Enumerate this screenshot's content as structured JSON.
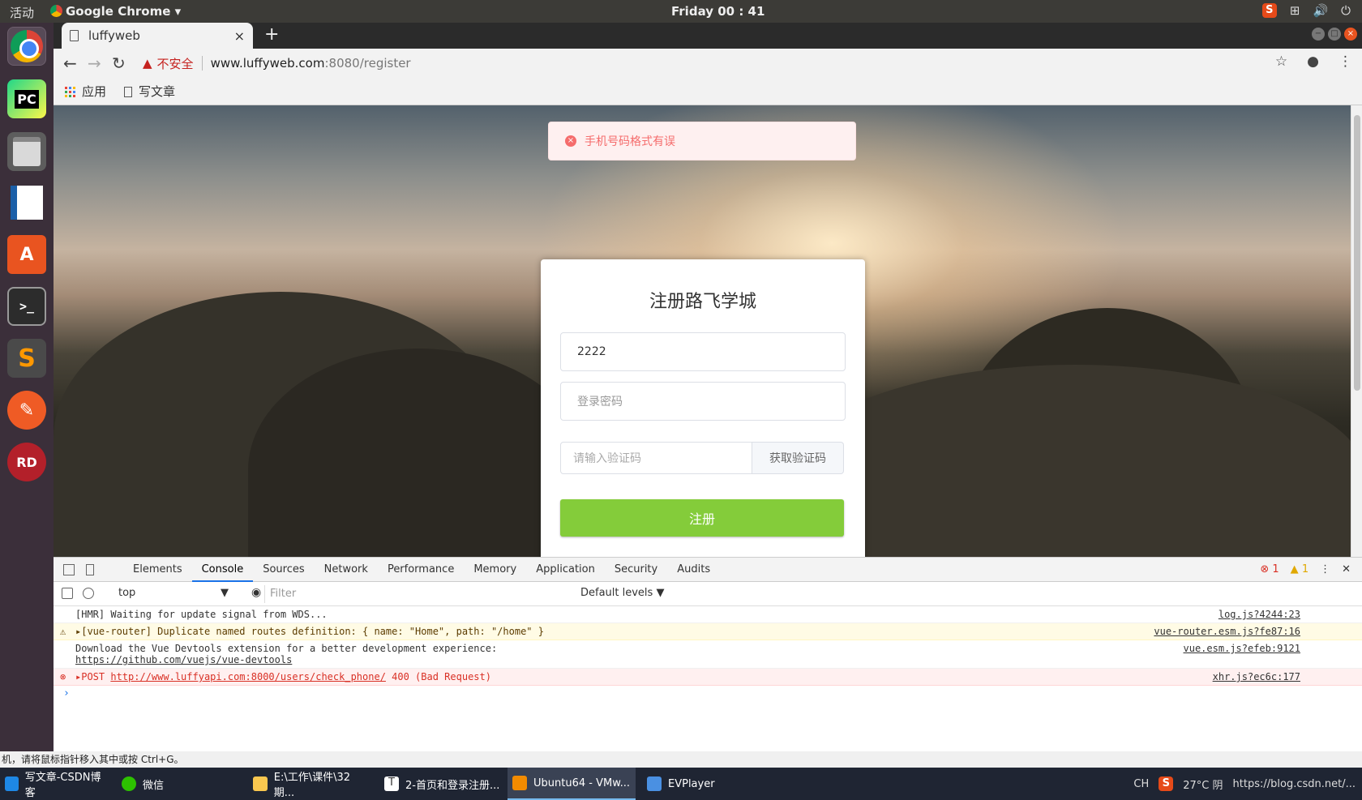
{
  "topbar": {
    "activities": "活动",
    "app_name": "Google Chrome",
    "app_menu_arrow": "▾",
    "clock": "Friday 00 : 41"
  },
  "launcher": {
    "pycharm_label": "PC",
    "terminal_label": ">_",
    "sublime_label": "S",
    "store_label": "A",
    "rdm_label": "RD"
  },
  "browser": {
    "tab_title": "luffyweb",
    "tab_close": "×",
    "new_tab": "+",
    "insecure_label": "不安全",
    "url_host": "www.luffyweb.com",
    "url_path": ":8080/register",
    "bookmarks": {
      "apps": "应用",
      "item1": "写文章"
    }
  },
  "page": {
    "error_message": "手机号码格式有误",
    "title": "注册路飞学城",
    "phone_value": "2222",
    "password_placeholder": "登录密码",
    "code_placeholder": "请输入验证码",
    "get_code_button": "获取验证码",
    "register_button": "注册"
  },
  "devtools": {
    "tabs": [
      "Elements",
      "Console",
      "Sources",
      "Network",
      "Performance",
      "Memory",
      "Application",
      "Security",
      "Audits"
    ],
    "active_tab": "Console",
    "error_count": "1",
    "warning_count": "1",
    "context": "top",
    "filter_placeholder": "Filter",
    "levels": "Default levels ▼",
    "logs": [
      {
        "type": "info",
        "text": "[HMR] Waiting for update signal from WDS...",
        "source": "log.js?4244:23"
      },
      {
        "type": "warn",
        "text": "▸[vue-router] Duplicate named routes definition: { name: \"Home\", path: \"/home\" }",
        "source": "vue-router.esm.js?fe87:16"
      },
      {
        "type": "info",
        "text": "Download the Vue Devtools extension for a better development experience:",
        "link": "https://github.com/vuejs/vue-devtools",
        "source": "vue.esm.js?efeb:9121"
      },
      {
        "type": "error",
        "prefix": "▸POST ",
        "link": "http://www.luffyapi.com:8000/users/check_phone/",
        "suffix": " 400 (Bad Request)",
        "source": "xhr.js?ec6c:177"
      }
    ],
    "prompt": "›"
  },
  "statusline": "机，请将鼠标指针移入其中或按 Ctrl+G。",
  "taskbar": {
    "items": [
      "写文章-CSDN博客",
      "微信",
      "E:\\工作\\课件\\32期...",
      "2-首页和登录注册...",
      "Ubuntu64 - VMw...",
      "EVPlayer"
    ],
    "tray_text": "https://blog.csdn.net/...",
    "weather": "27°C 阴",
    "ime": "CH"
  },
  "colors": {
    "register_green": "#84cc3a",
    "error_red": "#f56c6c",
    "accent_blue": "#1a73e8"
  }
}
